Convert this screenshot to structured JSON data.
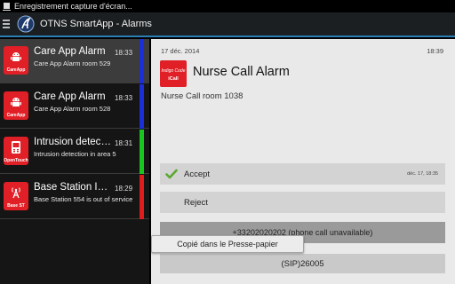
{
  "status_bar": {
    "notification_icon": "download-icon",
    "notification_text": "Enregistrement capture d'écran..."
  },
  "action_bar": {
    "menu_icon": "hamburger-menu-icon",
    "logo_icon": "alcatel-lucent-logo",
    "title": "OTNS SmartApp - Alarms",
    "accent": "#2b7fb4"
  },
  "alarm_list": [
    {
      "title": "Care App Alarm",
      "time": "18:33",
      "subtitle": "Care App Alarm room 529",
      "icon": "android-icon",
      "icon_caption": "CareApp",
      "bar_color": "#1b2ed8"
    },
    {
      "title": "Care App Alarm",
      "time": "18:33",
      "subtitle": "Care App Alarm room 528",
      "icon": "android-icon",
      "icon_caption": "CareApp",
      "bar_color": "#1b2ed8"
    },
    {
      "title": "Intrusion detection",
      "time": "18:31",
      "subtitle": "Intrusion detection in area 5",
      "icon": "phone-icon",
      "icon_caption": "OpenTouch",
      "bar_color": "#19c51f"
    },
    {
      "title": "Base Station Issue",
      "time": "18:29",
      "subtitle": "Base Station 554 is out of service",
      "icon": "antenna-icon",
      "icon_caption": "Base ST",
      "bar_color": "#e01c1c"
    }
  ],
  "detail": {
    "date": "17 déc. 2014",
    "time": "18:39",
    "icon_top_text": "Indigo Code",
    "icon_bottom_text": "iCall",
    "title": "Nurse Call Alarm",
    "room": "Nurse Call room 1038",
    "accept_label": "Accept",
    "accept_time": "déc. 17, 18:35",
    "reject_label": "Reject",
    "phone_label": "+33202020202 (phone call unavailable)",
    "sip_label": "(SIP)26005"
  },
  "toast": {
    "text": "Copié dans le Presse-papier"
  }
}
